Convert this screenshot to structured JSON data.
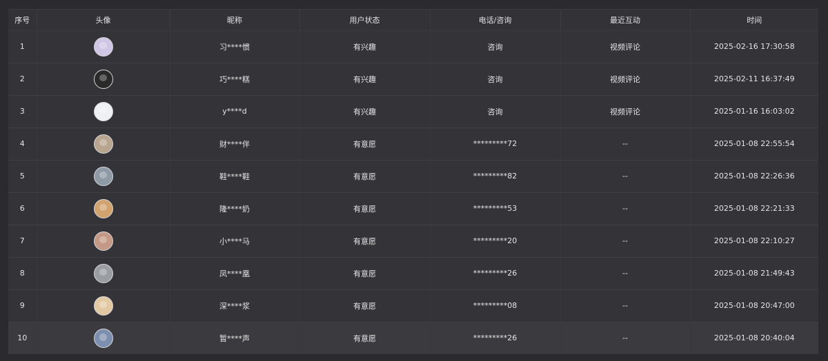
{
  "columns": [
    "序号",
    "头像",
    "昵称",
    "用户状态",
    "电话/咨询",
    "最近互动",
    "时间"
  ],
  "rows": [
    {
      "index": "1",
      "avatar_color": "#cfc6e6",
      "nickname": "习****惯",
      "status": "有兴趣",
      "contact": "咨询",
      "interaction": "视频评论",
      "time": "2025-02-16 17:30:58"
    },
    {
      "index": "2",
      "avatar_color": "#2a2a2a",
      "nickname": "巧****糕",
      "status": "有兴趣",
      "contact": "咨询",
      "interaction": "视频评论",
      "time": "2025-02-11 16:37:49"
    },
    {
      "index": "3",
      "avatar_color": "#eef0f4",
      "nickname": "y****d",
      "status": "有兴趣",
      "contact": "咨询",
      "interaction": "视频评论",
      "time": "2025-01-16 16:03:02"
    },
    {
      "index": "4",
      "avatar_color": "#b8a58f",
      "nickname": "财****伴",
      "status": "有意愿",
      "contact": "*********72",
      "interaction": "--",
      "time": "2025-01-08 22:55:54"
    },
    {
      "index": "5",
      "avatar_color": "#8e9aa6",
      "nickname": "鞋****鞋",
      "status": "有意愿",
      "contact": "*********82",
      "interaction": "--",
      "time": "2025-01-08 22:26:36"
    },
    {
      "index": "6",
      "avatar_color": "#d2a26f",
      "nickname": "隆****奶",
      "status": "有意愿",
      "contact": "*********53",
      "interaction": "--",
      "time": "2025-01-08 22:21:33"
    },
    {
      "index": "7",
      "avatar_color": "#c49a86",
      "nickname": "小****马",
      "status": "有意愿",
      "contact": "*********20",
      "interaction": "--",
      "time": "2025-01-08 22:10:27"
    },
    {
      "index": "8",
      "avatar_color": "#9a9ea2",
      "nickname": "凤****凰",
      "status": "有意愿",
      "contact": "*********26",
      "interaction": "--",
      "time": "2025-01-08 21:49:43"
    },
    {
      "index": "9",
      "avatar_color": "#e2c9a4",
      "nickname": "深****浆",
      "status": "有意愿",
      "contact": "*********08",
      "interaction": "--",
      "time": "2025-01-08 20:47:00"
    },
    {
      "index": "10",
      "avatar_color": "#7d8fae",
      "nickname": "暂****声",
      "status": "有意愿",
      "contact": "*********26",
      "interaction": "--",
      "time": "2025-01-08 20:40:04"
    }
  ]
}
